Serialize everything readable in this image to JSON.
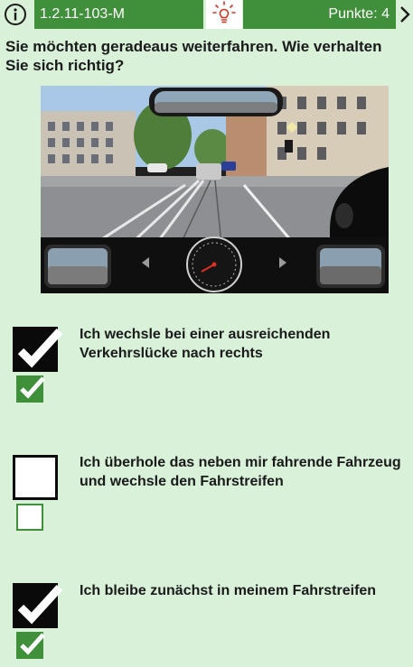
{
  "header": {
    "question_id": "1.2.11-103-M",
    "points": "Punkte: 4",
    "info_icon": "info-icon",
    "hint_icon": "lightbulb-icon",
    "next_icon": "chevron-right-icon"
  },
  "question": {
    "text": "Sie möchten geradeaus weiterfahren. Wie verhalten Sie sich richtig?"
  },
  "image": {
    "description_icon": "traffic-scene-image"
  },
  "answers": [
    {
      "text": "Ich wechsle bei einer ausreichenden Verkehrslücke nach rechts",
      "selected": true,
      "correct": true
    },
    {
      "text": "Ich überhole das neben mir fahrende Fahrzeug und wechsle den Fahrstreifen",
      "selected": false,
      "correct": false
    },
    {
      "text": "Ich bleibe zunächst in meinem Fahrstreifen",
      "selected": true,
      "correct": true
    }
  ],
  "colors": {
    "background": "#d9f0d9",
    "header_green": "#3f8f3b",
    "check_green": "#3f8f3b",
    "hint_red": "#e03020"
  }
}
